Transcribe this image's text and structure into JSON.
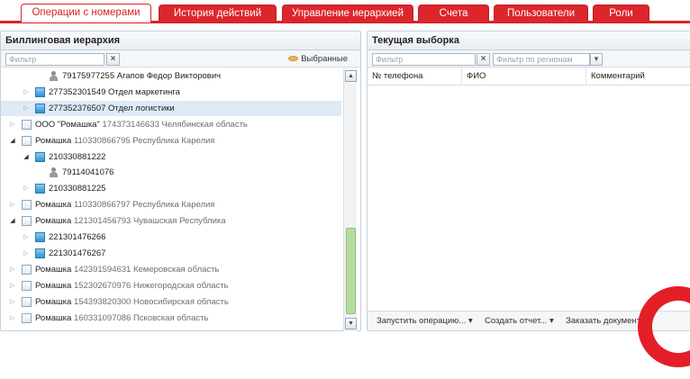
{
  "tabs": [
    {
      "label": "Операции с номерами",
      "active": true
    },
    {
      "label": "История действий",
      "active": false
    },
    {
      "label": "Управление иерархией",
      "active": false
    },
    {
      "label": "Счета",
      "active": false
    },
    {
      "label": "Пользователи",
      "active": false
    },
    {
      "label": "Роли",
      "active": false
    }
  ],
  "left_panel": {
    "title": "Биллинговая иерархия",
    "filter_placeholder": "Фильтр",
    "clear_button": "×",
    "favorites_label": "Выбранные",
    "tree": [
      {
        "type": "person",
        "expander": "",
        "number": "79175977255",
        "text": "Агапов Федор Викторович",
        "selected": false
      },
      {
        "type": "account",
        "expander": "collapsed",
        "number": "277352301549",
        "text": "Отдел маркетинга",
        "selected": false
      },
      {
        "type": "account",
        "expander": "collapsed",
        "number": "277352376507",
        "text": "Отдел логистики",
        "selected": true
      },
      {
        "type": "org",
        "expander": "collapsed",
        "number": "ООО \"Ромашка\"",
        "text": "174373146633 Челябинская область",
        "selected": false
      },
      {
        "type": "org",
        "expander": "expanded",
        "number": "Ромашка",
        "text": "110330866795 Республика Карелия",
        "selected": false
      },
      {
        "type": "account",
        "expander": "expanded",
        "number": "210330881222",
        "text": "",
        "selected": false
      },
      {
        "type": "person",
        "expander": "",
        "number": "79114041076",
        "text": "",
        "selected": false
      },
      {
        "type": "account",
        "expander": "collapsed",
        "number": "210330881225",
        "text": "",
        "selected": false
      },
      {
        "type": "org",
        "expander": "collapsed",
        "number": "Ромашка",
        "text": "110330866797 Республика Карелия",
        "selected": false
      },
      {
        "type": "org",
        "expander": "expanded",
        "number": "Ромашка",
        "text": "121301456793 Чувашская Республика",
        "selected": false
      },
      {
        "type": "account",
        "expander": "collapsed",
        "number": "221301476266",
        "text": "",
        "selected": false
      },
      {
        "type": "account",
        "expander": "collapsed",
        "number": "221301476267",
        "text": "",
        "selected": false
      },
      {
        "type": "org",
        "expander": "collapsed",
        "number": "Ромашка",
        "text": "142391594631 Кемеровская область",
        "selected": false
      },
      {
        "type": "org",
        "expander": "collapsed",
        "number": "Ромашка",
        "text": "152302670976 Нижегородская область",
        "selected": false
      },
      {
        "type": "org",
        "expander": "collapsed",
        "number": "Ромашка",
        "text": "154393820300 Новосибирская область",
        "selected": false
      },
      {
        "type": "org",
        "expander": "collapsed",
        "number": "Ромашка",
        "text": "160331097086 Псковская область",
        "selected": false
      }
    ]
  },
  "right_panel": {
    "title": "Текущая выборка",
    "filter_placeholder": "Фильтр",
    "clear_button": "×",
    "region_placeholder": "Фильтр по регионам",
    "columns": [
      "№ телефона",
      "ФИО",
      "Комментарий"
    ],
    "footer": {
      "run": "Запустить операцию... ▾",
      "report": "Создать отчет... ▾",
      "order": "Заказать документ"
    }
  },
  "colors": {
    "accent": "#d8232a",
    "selection": "#dfeaf7",
    "scroll_thumb": "#b7dca1"
  }
}
